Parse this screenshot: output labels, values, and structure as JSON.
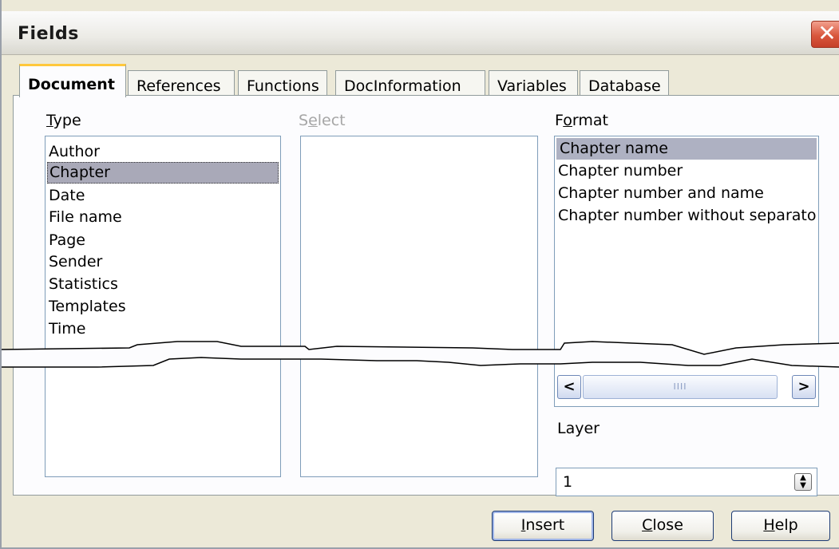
{
  "window": {
    "title": "Fields",
    "close_glyph": "✕"
  },
  "tabs": [
    {
      "label": "Document",
      "active": true
    },
    {
      "label": "References",
      "active": false
    },
    {
      "label": "Functions",
      "active": false
    },
    {
      "label": "DocInformation",
      "active": false
    },
    {
      "label": "Variables",
      "active": false
    },
    {
      "label": "Database",
      "active": false
    }
  ],
  "type_section": {
    "label_mnemonic": "T",
    "label_rest": "ype",
    "items": [
      "Author",
      "Chapter",
      "Date",
      "File name",
      "Page",
      "Sender",
      "Statistics",
      "Templates",
      "Time"
    ],
    "selected": "Chapter"
  },
  "select_section": {
    "label_pre": "S",
    "label_mnemonic": "e",
    "label_rest": "lect",
    "enabled": false
  },
  "format_section": {
    "label_pre": "F",
    "label_mnemonic": "o",
    "label_rest": "rmat",
    "items": [
      "Chapter name",
      "Chapter number",
      "Chapter number and name",
      "Chapter number without separato"
    ],
    "selected": "Chapter name",
    "scroll_grip": "IIII"
  },
  "layer": {
    "label": "Layer",
    "value": "1"
  },
  "buttons": {
    "insert": {
      "mnemonic": "I",
      "rest": "nsert"
    },
    "close": {
      "mnemonic": "C",
      "rest": "lose"
    },
    "help": {
      "mnemonic": "H",
      "rest": "elp"
    }
  },
  "colors": {
    "dialog_bg": "#ece9d8",
    "tab_highlight": "#ffc83c",
    "selection": "#a9a9b8",
    "close_button": "#d9573d"
  }
}
